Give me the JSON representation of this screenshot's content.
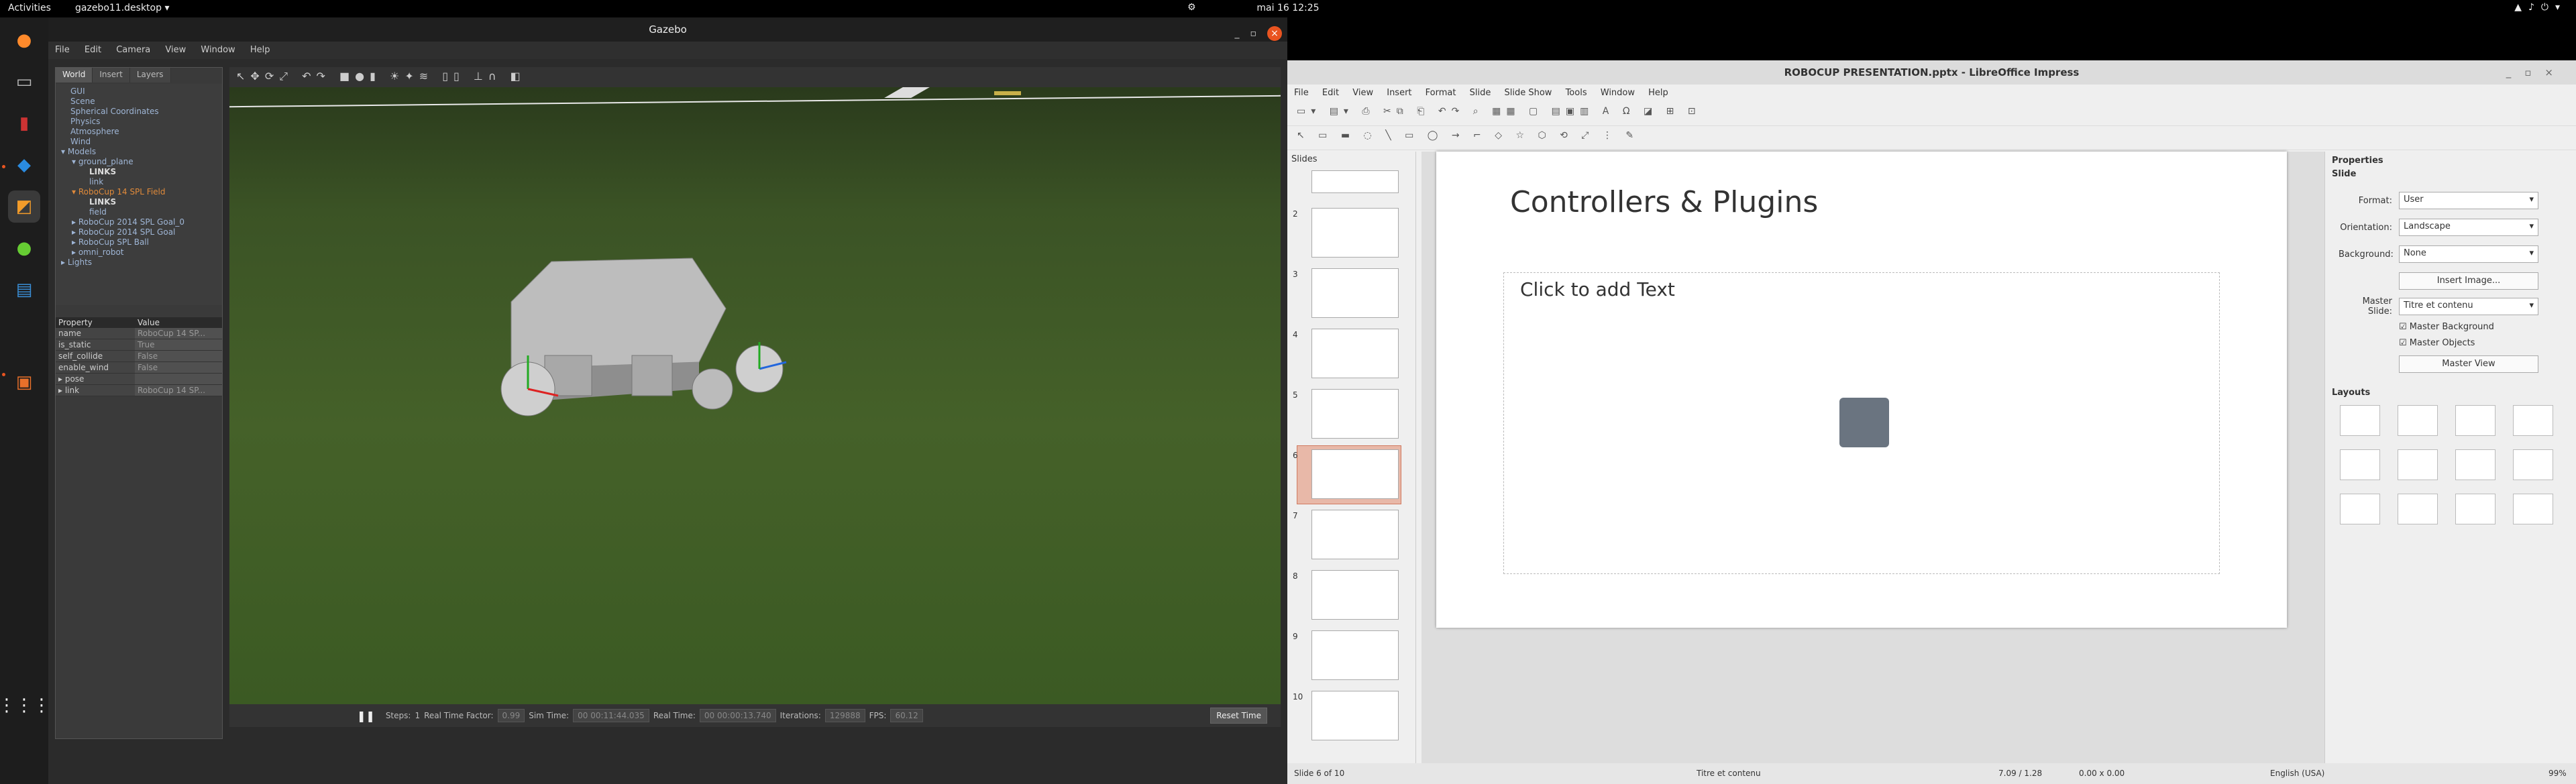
{
  "topbar": {
    "activities": "Activities",
    "app": "gazebo11.desktop ▾",
    "clock": "mai 16  12:25"
  },
  "gazebo": {
    "window_title": "Gazebo",
    "menu": [
      "File",
      "Edit",
      "Camera",
      "View",
      "Window",
      "Help"
    ],
    "tabs": [
      "World",
      "Insert",
      "Layers"
    ],
    "tree": [
      "GUI",
      "Scene",
      "Spherical Coordinates",
      "Physics",
      "Atmosphere",
      "Wind",
      "▾ Models",
      "▾ ground_plane",
      "LINKS",
      "link",
      "▾ RoboCup 14 SPL Field",
      "LINKS",
      "field",
      "▸ RoboCup 2014 SPL Goal_0",
      "▸ RoboCup 2014 SPL Goal",
      "▸ RoboCup SPL Ball",
      "▸ omni_robot",
      "▸ Lights"
    ],
    "prop_header": [
      "Property",
      "Value"
    ],
    "props": [
      [
        "name",
        "RoboCup 14 SP..."
      ],
      [
        "is_static",
        "True"
      ],
      [
        "self_collide",
        "False"
      ],
      [
        "enable_wind",
        "False"
      ],
      [
        "▸ pose",
        ""
      ],
      [
        "▸ link",
        "RoboCup 14 SP..."
      ]
    ],
    "bottom": {
      "steps_label": "Steps:",
      "steps": "1",
      "rtf_label": "Real Time Factor:",
      "rtf": "0.99",
      "sim_label": "Sim Time:",
      "sim": "00 00:11:44.035",
      "real_label": "Real Time:",
      "real": "00 00:00:13.740",
      "iter_label": "Iterations:",
      "iter": "129888",
      "fps_label": "FPS:",
      "fps": "60.12",
      "reset": "Reset Time"
    }
  },
  "impress": {
    "window_title": "ROBOCUP PRESENTATION.pptx - LibreOffice Impress",
    "menu": [
      "File",
      "Edit",
      "View",
      "Insert",
      "Format",
      "Slide",
      "Slide Show",
      "Tools",
      "Window",
      "Help"
    ],
    "slides_header": "Slides",
    "slide_numbers": [
      "2",
      "3",
      "4",
      "5",
      "6",
      "7",
      "8",
      "9",
      "10"
    ],
    "slide_title": "Controllers & Plugins",
    "placeholder": "Click to add Text",
    "properties": {
      "header": "Properties",
      "section": "Slide",
      "format_label": "Format:",
      "format": "User",
      "orientation_label": "Orientation:",
      "orientation": "Landscape",
      "background_label": "Background:",
      "background": "None",
      "insert_image": "Insert Image...",
      "master_label": "Master Slide:",
      "master": "Titre et contenu",
      "master_bg": "Master Background",
      "master_obj": "Master Objects",
      "master_view": "Master View",
      "layouts": "Layouts"
    },
    "status": {
      "slide": "Slide 6 of 10",
      "layout": "Titre et contenu",
      "pos": "7.09 / 1.28",
      "size": "0.00 x 0.00",
      "lang": "English (USA)",
      "zoom": "99%"
    }
  }
}
